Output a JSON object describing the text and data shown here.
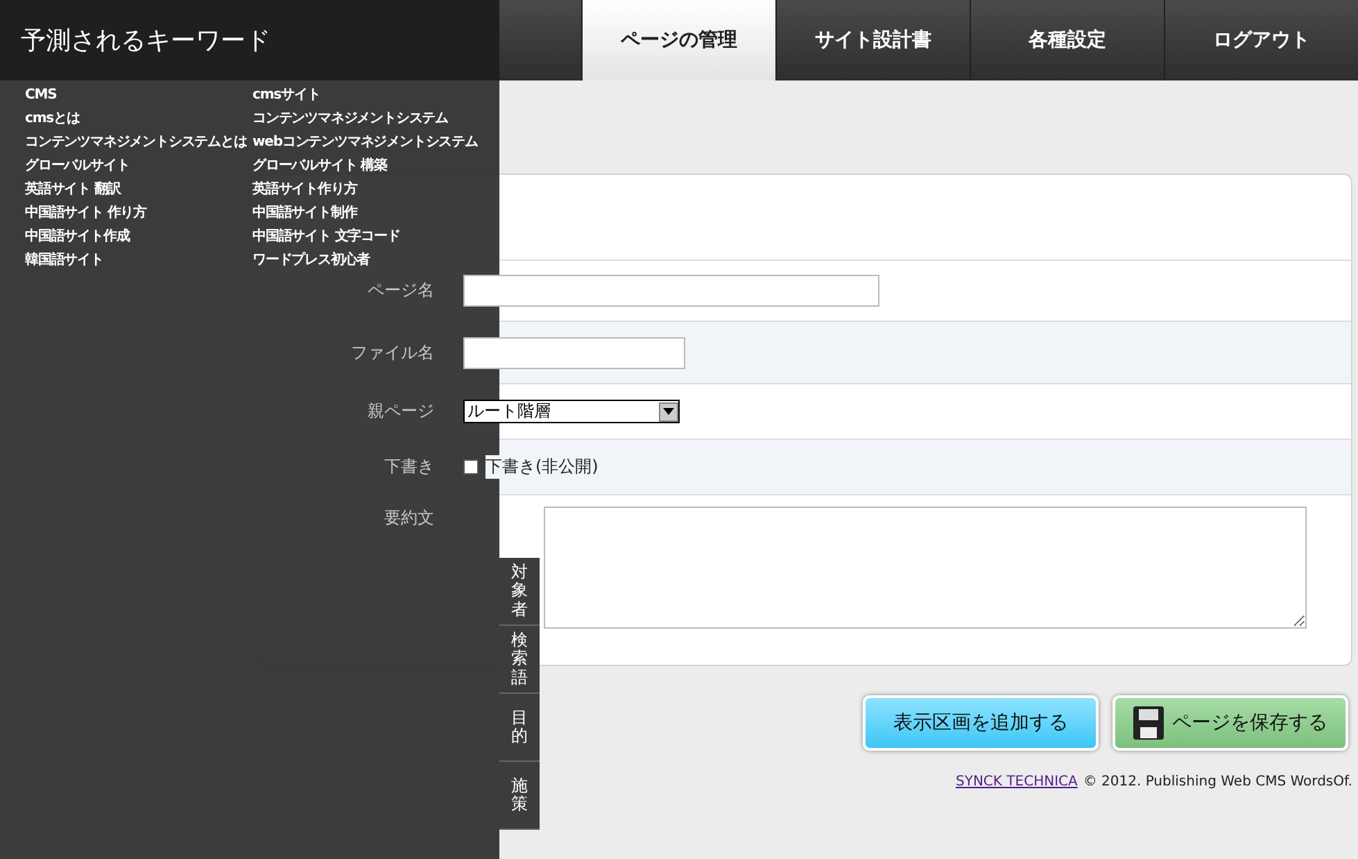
{
  "header": {
    "nav": [
      {
        "label": "ページの管理",
        "selected": true
      },
      {
        "label": "サイト設計書",
        "selected": false
      },
      {
        "label": "各種設定",
        "selected": false
      },
      {
        "label": "ログアウト",
        "selected": false
      }
    ]
  },
  "form": {
    "rows": [
      {
        "kind": "text",
        "label": "ページ名",
        "wide": true
      },
      {
        "kind": "text",
        "label": "ファイル名",
        "wide": false
      },
      {
        "kind": "select",
        "label": "親ページ",
        "value": "ルート階層"
      },
      {
        "kind": "checkbox",
        "label": "下書き",
        "option": "下書き(非公開)",
        "checked": false
      },
      {
        "kind": "textarea",
        "label": "要約文"
      }
    ]
  },
  "actions": [
    {
      "kind": "add",
      "label": "表示区画を追加する"
    },
    {
      "kind": "save",
      "label": "ページを保存する"
    }
  ],
  "footer": {
    "link": "SYNCK TECHNICA",
    "text": "© 2012. Publishing Web CMS WordsOf."
  },
  "keyword_panel": {
    "title": "予測されるキーワード",
    "keywords": [
      "CMS",
      "cmsサイト",
      "cmsとは",
      "コンテンツマネジメントシステム",
      "コンテンツマネジメントシステムとは",
      "webコンテンツマネジメントシステム",
      "グローバルサイト",
      "グローバルサイト 構築",
      "英語サイト 翻訳",
      "英語サイト作り方",
      "中国語サイト 作り方",
      "中国語サイト制作",
      "中国語サイト作成",
      "中国語サイト 文字コード",
      "韓国語サイト",
      "ワードプレス初心者"
    ],
    "side_tabs": [
      {
        "label": "対象者",
        "selected": false
      },
      {
        "label": "検索語",
        "selected": false
      },
      {
        "label": "目的",
        "selected": false
      },
      {
        "label": "施策",
        "selected": false
      }
    ]
  }
}
